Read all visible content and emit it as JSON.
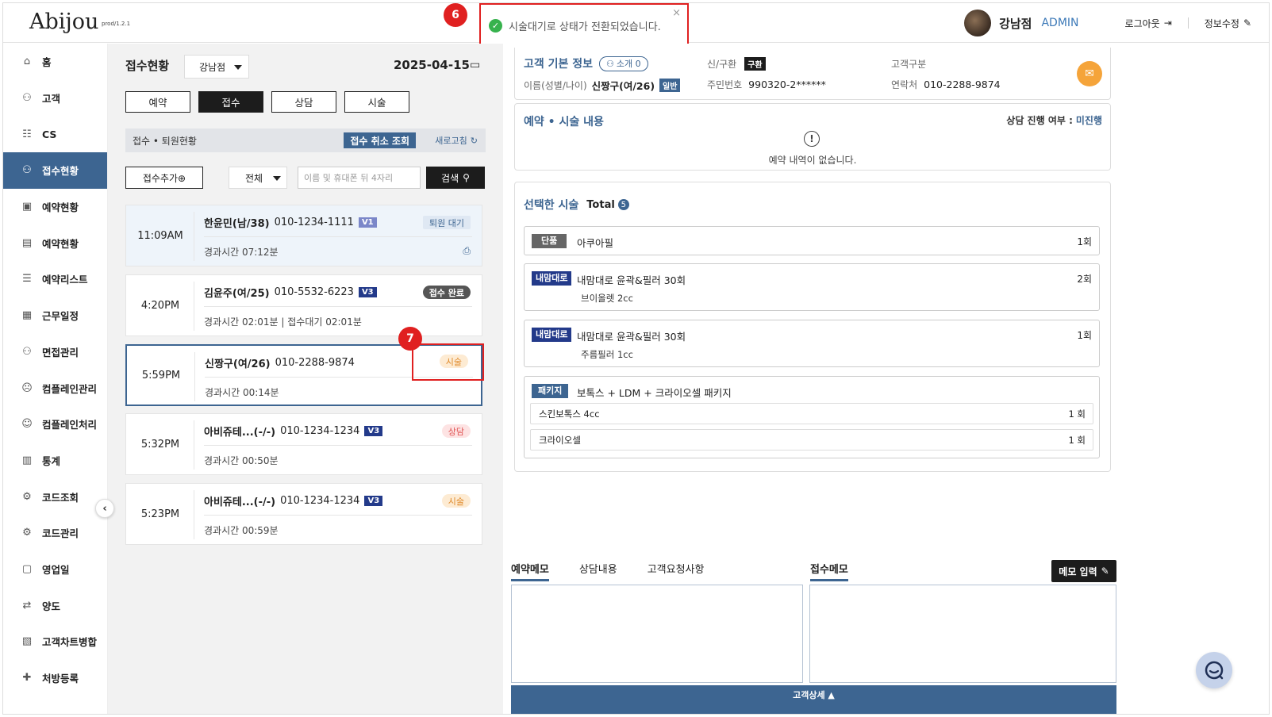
{
  "header": {
    "logo": "Abijou",
    "version": "prod/1.2.1",
    "branch_name": "강남점",
    "role": "ADMIN",
    "logout": "로그아웃",
    "edit_info": "정보수정"
  },
  "toast": {
    "message": "시술대기로 상태가 전환되었습니다.",
    "close": "×",
    "marker": "6"
  },
  "marker7": "7",
  "sidebar": {
    "items": [
      {
        "label": "홈",
        "icon": "⌂"
      },
      {
        "label": "고객",
        "icon": "⚇"
      },
      {
        "label": "CS",
        "icon": "☷"
      },
      {
        "label": "접수현황",
        "icon": "⚇"
      },
      {
        "label": "예약현황",
        "icon": "▣"
      },
      {
        "label": "예약현황",
        "icon": "▤"
      },
      {
        "label": "예약리스트",
        "icon": "☰"
      },
      {
        "label": "근무일정",
        "icon": "▦"
      },
      {
        "label": "면접관리",
        "icon": "⚇"
      },
      {
        "label": "컴플레인관리",
        "icon": "☹"
      },
      {
        "label": "컴플레인처리",
        "icon": "☺"
      },
      {
        "label": "통계",
        "icon": "▥"
      },
      {
        "label": "코드조회",
        "icon": "⚙"
      },
      {
        "label": "코드관리",
        "icon": "⚙"
      },
      {
        "label": "영업일",
        "icon": "▢"
      },
      {
        "label": "양도",
        "icon": "⇄"
      },
      {
        "label": "고객차트병합",
        "icon": "▧"
      },
      {
        "label": "처방등록",
        "icon": "✚"
      }
    ],
    "collapse": "‹"
  },
  "reception": {
    "title": "접수현황",
    "branch": "강남점",
    "date": "2025-04-15",
    "tabs": [
      "예약",
      "접수",
      "상담",
      "시술"
    ],
    "bar_title": "접수 • 퇴원현황",
    "cancel_lookup": "접수 취소 조회",
    "refresh": "새로고침",
    "add_button": "접수추가⊕",
    "filter": "전체",
    "search_placeholder": "이름 및 휴대폰 뒤 4자리",
    "search_button": "검색",
    "cards": [
      {
        "time": "11:09AM",
        "name": "한윤민(남/38)",
        "phone": "010-1234-1111",
        "badge": "V1",
        "status": "퇴원 대기",
        "sub": "경과시간 07:12분"
      },
      {
        "time": "4:20PM",
        "name": "김윤주(여/25)",
        "phone": "010-5532-6223",
        "badge": "V3",
        "status": "접수 완료",
        "sub": "경과시간 02:01분 | 접수대기 02:01분"
      },
      {
        "time": "5:59PM",
        "name": "신짱구(여/26)",
        "phone": "010-2288-9874",
        "badge": "",
        "status": "시술",
        "sub": "경과시간 00:14분"
      },
      {
        "time": "5:32PM",
        "name": "아비쥬테...(-/-)",
        "phone": "010-1234-1234",
        "badge": "V3",
        "status": "상담",
        "sub": "경과시간 00:50분"
      },
      {
        "time": "5:23PM",
        "name": "아비쥬테...(-/-)",
        "phone": "010-1234-1234",
        "badge": "V3",
        "status": "시술",
        "sub": "경과시간 00:59분"
      }
    ]
  },
  "customer": {
    "section_title": "고객 기본 정보",
    "referral": "소개 0",
    "name_label": "이름(성별/나이)",
    "name_value": "신짱구(여/26)",
    "grade": "일반",
    "type_label": "신/구환",
    "type_value": "구환",
    "ssn_label": "주민번호",
    "ssn_value": "990320-2******",
    "category_label": "고객구분",
    "contact_label": "연락처",
    "contact_value": "010-2288-9874"
  },
  "reservation": {
    "title": "예약 • 시술 내용",
    "consult_label": "상담 진행 여부 :",
    "consult_value": "미진행",
    "empty": "예약 내역이 없습니다."
  },
  "procedures": {
    "title": "선택한 시술",
    "total_label": "Total",
    "total_count": "5",
    "items": [
      {
        "tag": "단품",
        "name": "아쿠아필",
        "count": "1회",
        "sub": ""
      },
      {
        "tag": "내맘대로",
        "name": "내맘대로 윤곽&필러 30회",
        "count": "2회",
        "sub": "브이올렛 2cc"
      },
      {
        "tag": "내맘대로",
        "name": "내맘대로 윤곽&필러 30회",
        "count": "1회",
        "sub": "주름필러 1cc"
      }
    ],
    "package": {
      "tag": "패키지",
      "name": "보톡스 + LDM + 크라이오셀 패키지",
      "rows": [
        {
          "name": "스킨보톡스 4cc",
          "count": "1 회"
        },
        {
          "name": "크라이오셀",
          "count": "1 회"
        }
      ]
    }
  },
  "memo": {
    "tabs": [
      "예약메모",
      "상담내용",
      "고객요청사항"
    ],
    "reception_memo": "접수메모",
    "input_button": "메모 입력",
    "detail_bar": "고객상세 ▲"
  },
  "colors": {
    "primary": "#3d6591",
    "toast_green": "#37b24d",
    "highlight_red": "#e02020"
  }
}
